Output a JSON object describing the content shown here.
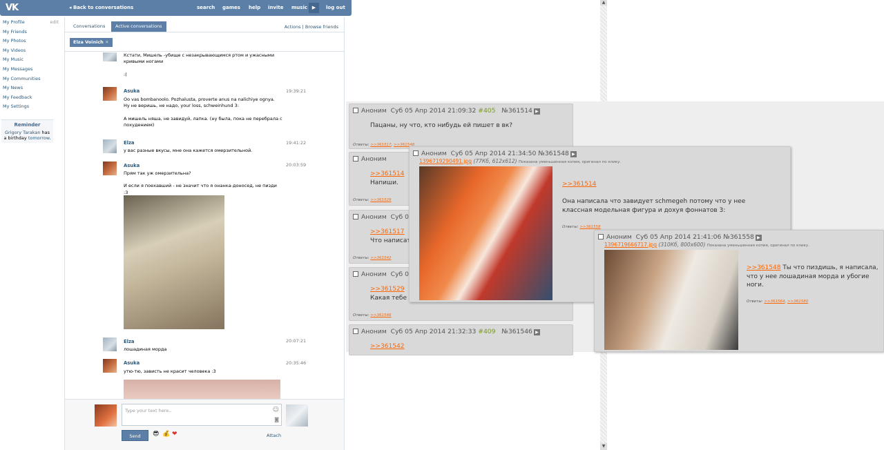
{
  "vk": {
    "logo": "VK",
    "back_label": "Back to conversations",
    "nav": [
      "search",
      "games",
      "help",
      "invite",
      "music",
      "log out"
    ],
    "sidebar": [
      {
        "label": "My Profile",
        "extra": "edit"
      },
      {
        "label": "My Friends"
      },
      {
        "label": "My Photos"
      },
      {
        "label": "My Videos"
      },
      {
        "label": "My Music"
      },
      {
        "label": "My Messages"
      },
      {
        "label": "My Communities"
      },
      {
        "label": "My News"
      },
      {
        "label": "My Feedback"
      },
      {
        "label": "My Settings"
      }
    ],
    "reminder": {
      "title": "Reminder",
      "name": "Grigory Tarakan",
      "text": " has a birthday ",
      "when": "tomorrow",
      "end": "."
    },
    "tabs": [
      "Conversations",
      "Active conversations"
    ],
    "tab_actions": "Actions | Browse friends",
    "peer": "Elza Voinich",
    "messages": [
      {
        "author": "",
        "time": "",
        "avatar": "elza",
        "text": "Кстати, Мишель -убище с незакрывающимся ртом и ужасными\nкривыми ногами\n\n:("
      },
      {
        "author": "Asuka",
        "time": "19:39:21",
        "avatar": "asuka",
        "text": "Oo vas bombanoolo. Pozhalusta, proverte anus na nalichiye ognya.\nНу не веришь, не надо, your loss, schweinhund 3:\n\nА мишель няша, не завидуй, лапка. (ну была, пока не перебрала с\nпохудением)"
      },
      {
        "author": "Elza",
        "time": "19:41:22",
        "avatar": "elza",
        "text": "у вас разные вкусы, мне она кажется омерзительной."
      },
      {
        "author": "Asuka",
        "time": "20:03:59",
        "avatar": "asuka",
        "text": "Прям так уж омерзительна?\n\nИ если я поехавший - не значит что я онанка-доносед, не пизди :3"
      },
      {
        "author": "Elza",
        "time": "20:07:21",
        "avatar": "elza",
        "text": "лошадиная морда"
      },
      {
        "author": "Asuka",
        "time": "20:35:46",
        "avatar": "asuka",
        "text": "утю-тю, зависть не красит человека :3"
      }
    ],
    "compose": {
      "placeholder": "Type your text here..",
      "send": "Send",
      "attach": "Attach"
    },
    "emojis": [
      "😎",
      "💰",
      "❤"
    ]
  },
  "board": {
    "posts": [
      {
        "name": "Аноним",
        "date": "Суб 05 Апр 2014 21:09:32",
        "ord": "#405",
        "no": "№361514",
        "text": "Пацаны, ну что, кто нибудь ей пишет в вк?",
        "replies_label": "Ответы:",
        "replies": [
          ">>361517",
          ">>361548"
        ]
      },
      {
        "name": "Аноним",
        "date": "",
        "ord": "",
        "no": "",
        "link": ">>361514",
        "text": "Напиши.",
        "replies_label": "Ответы:",
        "replies": [
          ">>361529"
        ]
      },
      {
        "name": "Аноним",
        "date": "Суб 0",
        "ord": "",
        "no": "",
        "link": ">>361517",
        "text": "Что написать",
        "replies_label": "Ответы:",
        "replies": [
          ">>361542"
        ]
      },
      {
        "name": "Аноним",
        "date": "Суб 0",
        "ord": "",
        "no": "",
        "link": ">>361529",
        "text": "Какая тебе р",
        "replies_label": "Ответы:",
        "replies": [
          ">>361546"
        ]
      },
      {
        "name": "Аноним",
        "date": "Суб 05 Апр 2014 21:32:33",
        "ord": "#409",
        "no": "№361546",
        "link": ">>361542",
        "text": ""
      }
    ],
    "popup1": {
      "name": "Аноним",
      "date": "Суб 05 Апр 2014 21:34:50",
      "no": "№361548",
      "file": "1396719290491.jpg",
      "meta": "(77Кб, 612x612)",
      "note": "Показана уменьшенная копия, оригинал по клику.",
      "link": ">>361514",
      "text": "Она написала что завидует schmegeh потому что у нее\nклассная модельная фигура и дохуя фоннатов 3:",
      "replies_label": "Ответы:",
      "replies": [
        ">>361558"
      ]
    },
    "popup2": {
      "name": "Аноним",
      "date": "Суб 05 Апр 2014 21:41:06",
      "no": "№361558",
      "file": "1396719666717.jpg",
      "meta": "(310Кб, 800x600)",
      "note": "Показана уменьшенная копия, оригинал по клику.",
      "link": ">>361548",
      "text": " Ты что пиздишь, я написала,\nчто у нее лошадиная морда и убогие\nноги.",
      "replies_label": "Ответы:",
      "replies": [
        ">>361564",
        ">>361580"
      ]
    }
  }
}
